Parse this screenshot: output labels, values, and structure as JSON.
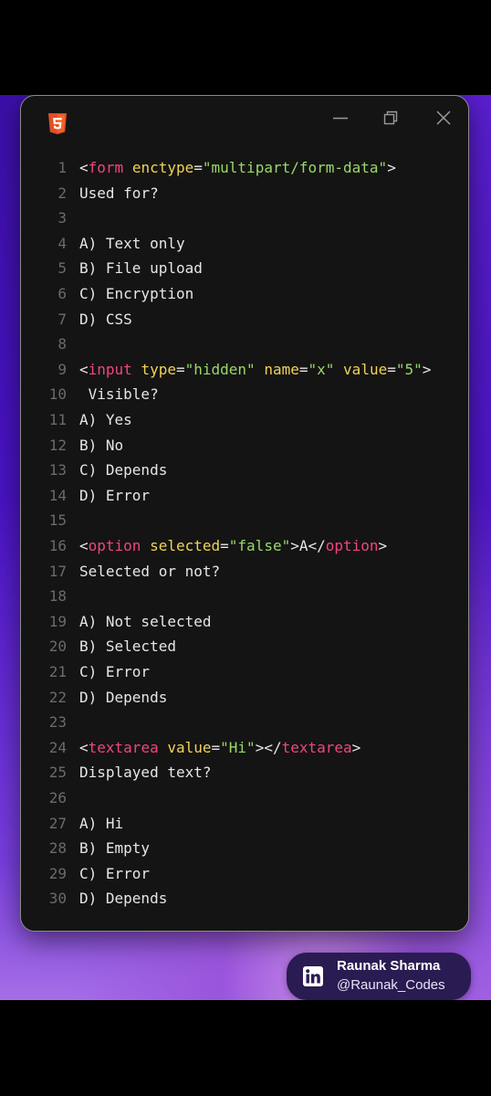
{
  "window": {
    "icons": {
      "app": "html5-icon",
      "minimize": "minimize-icon",
      "restore": "restore-icon",
      "close": "close-icon"
    }
  },
  "colors": {
    "tag": "#f0467a",
    "attribute": "#f1d25a",
    "string": "#9ad86a",
    "text": "#e6e6e6",
    "line_number": "#6b6b6b",
    "editor_background": "#141414"
  },
  "code_lines": [
    {
      "n": "1",
      "tokens": [
        {
          "t": "<",
          "c": "punc"
        },
        {
          "t": "form",
          "c": "tag"
        },
        {
          "t": " ",
          "c": "punc"
        },
        {
          "t": "enctype",
          "c": "attr"
        },
        {
          "t": "=",
          "c": "punc"
        },
        {
          "t": "\"multipart/form-data\"",
          "c": "str"
        },
        {
          "t": ">",
          "c": "punc"
        }
      ]
    },
    {
      "n": "2",
      "tokens": [
        {
          "t": "Used for?",
          "c": "punc"
        }
      ]
    },
    {
      "n": "3",
      "tokens": []
    },
    {
      "n": "4",
      "tokens": [
        {
          "t": "A) Text only",
          "c": "punc"
        }
      ]
    },
    {
      "n": "5",
      "tokens": [
        {
          "t": "B) File upload",
          "c": "punc"
        }
      ]
    },
    {
      "n": "6",
      "tokens": [
        {
          "t": "C) Encryption",
          "c": "punc"
        }
      ]
    },
    {
      "n": "7",
      "tokens": [
        {
          "t": "D) CSS",
          "c": "punc"
        }
      ]
    },
    {
      "n": "8",
      "tokens": []
    },
    {
      "n": "9",
      "tokens": [
        {
          "t": "<",
          "c": "punc"
        },
        {
          "t": "input",
          "c": "tag"
        },
        {
          "t": " ",
          "c": "punc"
        },
        {
          "t": "type",
          "c": "attr"
        },
        {
          "t": "=",
          "c": "punc"
        },
        {
          "t": "\"hidden\"",
          "c": "str"
        },
        {
          "t": " ",
          "c": "punc"
        },
        {
          "t": "name",
          "c": "attr"
        },
        {
          "t": "=",
          "c": "punc"
        },
        {
          "t": "\"x\"",
          "c": "str"
        },
        {
          "t": " ",
          "c": "punc"
        },
        {
          "t": "value",
          "c": "attr"
        },
        {
          "t": "=",
          "c": "punc"
        },
        {
          "t": "\"5\"",
          "c": "str"
        },
        {
          "t": ">",
          "c": "punc"
        }
      ]
    },
    {
      "n": "10",
      "tokens": [
        {
          "t": " Visible?",
          "c": "punc"
        }
      ]
    },
    {
      "n": "11",
      "tokens": [
        {
          "t": "A) Yes",
          "c": "punc"
        }
      ]
    },
    {
      "n": "12",
      "tokens": [
        {
          "t": "B) No",
          "c": "punc"
        }
      ]
    },
    {
      "n": "13",
      "tokens": [
        {
          "t": "C) Depends",
          "c": "punc"
        }
      ]
    },
    {
      "n": "14",
      "tokens": [
        {
          "t": "D) Error",
          "c": "punc"
        }
      ]
    },
    {
      "n": "15",
      "tokens": []
    },
    {
      "n": "16",
      "tokens": [
        {
          "t": "<",
          "c": "punc"
        },
        {
          "t": "option",
          "c": "tag"
        },
        {
          "t": " ",
          "c": "punc"
        },
        {
          "t": "selected",
          "c": "attr"
        },
        {
          "t": "=",
          "c": "punc"
        },
        {
          "t": "\"false\"",
          "c": "str"
        },
        {
          "t": ">A</",
          "c": "punc"
        },
        {
          "t": "option",
          "c": "tag"
        },
        {
          "t": ">",
          "c": "punc"
        }
      ]
    },
    {
      "n": "17",
      "tokens": [
        {
          "t": "Selected or not?",
          "c": "punc"
        }
      ]
    },
    {
      "n": "18",
      "tokens": []
    },
    {
      "n": "19",
      "tokens": [
        {
          "t": "A) Not selected",
          "c": "punc"
        }
      ]
    },
    {
      "n": "20",
      "tokens": [
        {
          "t": "B) Selected",
          "c": "punc"
        }
      ]
    },
    {
      "n": "21",
      "tokens": [
        {
          "t": "C) Error",
          "c": "punc"
        }
      ]
    },
    {
      "n": "22",
      "tokens": [
        {
          "t": "D) Depends",
          "c": "punc"
        }
      ]
    },
    {
      "n": "23",
      "tokens": []
    },
    {
      "n": "24",
      "tokens": [
        {
          "t": "<",
          "c": "punc"
        },
        {
          "t": "textarea",
          "c": "tag"
        },
        {
          "t": " ",
          "c": "punc"
        },
        {
          "t": "value",
          "c": "attr"
        },
        {
          "t": "=",
          "c": "punc"
        },
        {
          "t": "\"Hi\"",
          "c": "str"
        },
        {
          "t": "></",
          "c": "punc"
        },
        {
          "t": "textarea",
          "c": "tag"
        },
        {
          "t": ">",
          "c": "punc"
        }
      ]
    },
    {
      "n": "25",
      "tokens": [
        {
          "t": "Displayed text?",
          "c": "punc"
        }
      ]
    },
    {
      "n": "26",
      "tokens": []
    },
    {
      "n": "27",
      "tokens": [
        {
          "t": "A) Hi",
          "c": "punc"
        }
      ]
    },
    {
      "n": "28",
      "tokens": [
        {
          "t": "B) Empty",
          "c": "punc"
        }
      ]
    },
    {
      "n": "29",
      "tokens": [
        {
          "t": "C) Error",
          "c": "punc"
        }
      ]
    },
    {
      "n": "30",
      "tokens": [
        {
          "t": "D) Depends",
          "c": "punc"
        }
      ]
    }
  ],
  "author": {
    "name": "Raunak Sharma",
    "handle": "@Raunak_Codes",
    "icon": "linkedin-icon"
  }
}
